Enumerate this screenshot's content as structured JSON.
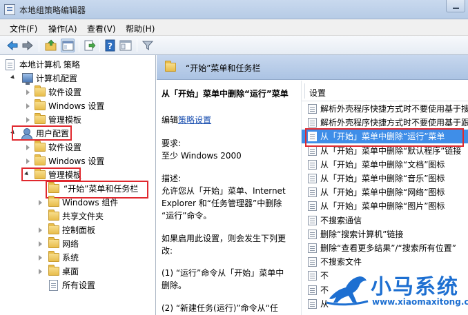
{
  "window": {
    "title": "本地组策略编辑器"
  },
  "menu": [
    "文件(F)",
    "操作(A)",
    "查看(V)",
    "帮助(H)"
  ],
  "tree": {
    "root": "本地计算机 策略",
    "computer_config": "计算机配置",
    "computer_children": [
      "软件设置",
      "Windows 设置",
      "管理模板"
    ],
    "user_config": "用户配置",
    "user_children": [
      "软件设置",
      "Windows 设置"
    ],
    "admin_templates": "管理模板",
    "start_menu": "“开始”菜单和任务栏",
    "admin_children": [
      "Windows 组件",
      "共享文件夹",
      "控制面板",
      "网络",
      "系统",
      "桌面",
      "所有设置"
    ]
  },
  "header": {
    "title": "“开始”菜单和任务栏"
  },
  "description": {
    "title": "从「开始」菜单中删除“运行”菜单",
    "edit_prefix": "编辑",
    "edit_link": "策略设置",
    "req_label": "要求:",
    "req_value": "至少 Windows 2000",
    "desc_label": "描述:",
    "lines": [
      "允许您从「开始」菜单、Internet",
      "Explorer 和“任务管理器”中删除",
      "“运行”命令。",
      "",
      "如果启用此设置，则会发生下列更",
      "改:",
      "",
      "(1) “运行”命令从「开始」菜单中",
      "删除。",
      "",
      "(2) “新建任务(运行)”命令从“任"
    ]
  },
  "list": {
    "column": "设置",
    "rows": [
      "解析外壳程序快捷方式时不要使用基于搜",
      "解析外壳程序快捷方式时不要使用基于跟",
      "从「开始」菜单中删除“运行”菜单",
      "从「开始」菜单中删除“默认程序”链接",
      "从「开始」菜单中删除“文档”图标",
      "从「开始」菜单中删除“音乐”图标",
      "从「开始」菜单中删除“网络”图标",
      "从「开始」菜单中删除“图片”图标",
      "不搜索通信",
      "删除“搜索计算机”链接",
      "删除“查看更多结果”/“搜索所有位置”",
      "不搜索文件",
      "不",
      "不",
      "从"
    ],
    "selected_index": 2
  },
  "watermark": {
    "brand": "小马系统",
    "url": "www.xiaomaxitong.com"
  },
  "colors": {
    "highlight_box": "#e0282e",
    "selection": "#3f8ee8",
    "brand": "#1d6fd1"
  }
}
